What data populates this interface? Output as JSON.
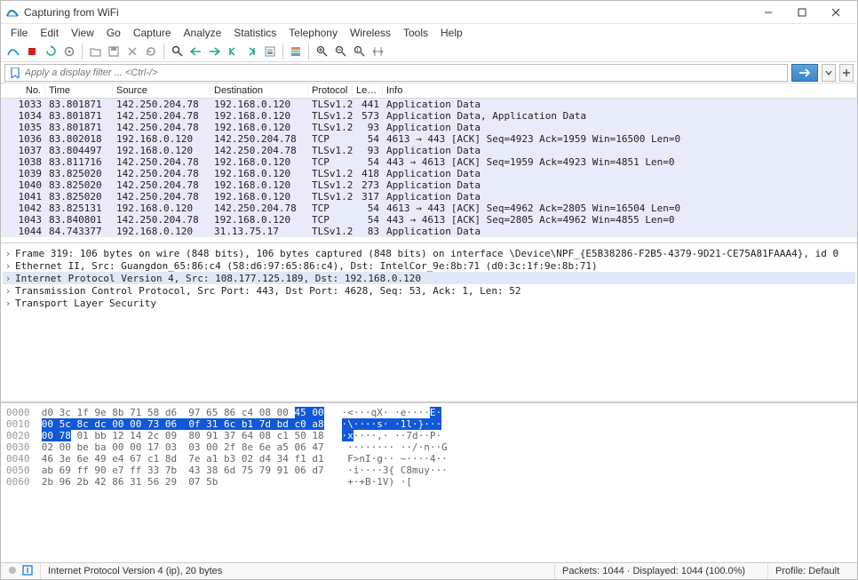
{
  "window": {
    "title": "Capturing from WiFi"
  },
  "menu": [
    "File",
    "Edit",
    "View",
    "Go",
    "Capture",
    "Analyze",
    "Statistics",
    "Telephony",
    "Wireless",
    "Tools",
    "Help"
  ],
  "filter": {
    "placeholder": "Apply a display filter ... <Ctrl-/>"
  },
  "list": {
    "headers": [
      "No.",
      "Time",
      "Source",
      "Destination",
      "Protocol",
      "Length",
      "Info"
    ],
    "rows": [
      {
        "no": "1033",
        "time": "83.801871",
        "src": "142.250.204.78",
        "dst": "192.168.0.120",
        "proto": "TLSv1.2",
        "len": "441",
        "info": "Application Data"
      },
      {
        "no": "1034",
        "time": "83.801871",
        "src": "142.250.204.78",
        "dst": "192.168.0.120",
        "proto": "TLSv1.2",
        "len": "573",
        "info": "Application Data, Application Data"
      },
      {
        "no": "1035",
        "time": "83.801871",
        "src": "142.250.204.78",
        "dst": "192.168.0.120",
        "proto": "TLSv1.2",
        "len": "93",
        "info": "Application Data"
      },
      {
        "no": "1036",
        "time": "83.802018",
        "src": "192.168.0.120",
        "dst": "142.250.204.78",
        "proto": "TCP",
        "len": "54",
        "info": "4613 → 443 [ACK] Seq=4923 Ack=1959 Win=16500 Len=0"
      },
      {
        "no": "1037",
        "time": "83.804497",
        "src": "192.168.0.120",
        "dst": "142.250.204.78",
        "proto": "TLSv1.2",
        "len": "93",
        "info": "Application Data"
      },
      {
        "no": "1038",
        "time": "83.811716",
        "src": "142.250.204.78",
        "dst": "192.168.0.120",
        "proto": "TCP",
        "len": "54",
        "info": "443 → 4613 [ACK] Seq=1959 Ack=4923 Win=4851 Len=0"
      },
      {
        "no": "1039",
        "time": "83.825020",
        "src": "142.250.204.78",
        "dst": "192.168.0.120",
        "proto": "TLSv1.2",
        "len": "418",
        "info": "Application Data"
      },
      {
        "no": "1040",
        "time": "83.825020",
        "src": "142.250.204.78",
        "dst": "192.168.0.120",
        "proto": "TLSv1.2",
        "len": "273",
        "info": "Application Data"
      },
      {
        "no": "1041",
        "time": "83.825020",
        "src": "142.250.204.78",
        "dst": "192.168.0.120",
        "proto": "TLSv1.2",
        "len": "317",
        "info": "Application Data"
      },
      {
        "no": "1042",
        "time": "83.825131",
        "src": "192.168.0.120",
        "dst": "142.250.204.78",
        "proto": "TCP",
        "len": "54",
        "info": "4613 → 443 [ACK] Seq=4962 Ack=2805 Win=16504 Len=0"
      },
      {
        "no": "1043",
        "time": "83.840801",
        "src": "142.250.204.78",
        "dst": "192.168.0.120",
        "proto": "TCP",
        "len": "54",
        "info": "443 → 4613 [ACK] Seq=2805 Ack=4962 Win=4855 Len=0"
      },
      {
        "no": "1044",
        "time": "84.743377",
        "src": "192.168.0.120",
        "dst": "31.13.75.17",
        "proto": "TLSv1.2",
        "len": "83",
        "info": "Application Data"
      }
    ]
  },
  "details": [
    {
      "text": "Frame 319: 106 bytes on wire (848 bits), 106 bytes captured (848 bits) on interface \\Device\\NPF_{E5B38286-F2B5-4379-9D21-CE75A81FAAA4}, id 0",
      "sel": false
    },
    {
      "text": "Ethernet II, Src: Guangdon_65:86:c4 (58:d6:97:65:86:c4), Dst: IntelCor_9e:8b:71 (d0:3c:1f:9e:8b:71)",
      "sel": false
    },
    {
      "text": "Internet Protocol Version 4, Src: 108.177.125.189, Dst: 192.168.0.120",
      "sel": true
    },
    {
      "text": "Transmission Control Protocol, Src Port: 443, Dst Port: 4628, Seq: 53, Ack: 1, Len: 52",
      "sel": false
    },
    {
      "text": "Transport Layer Security",
      "sel": false
    }
  ],
  "hex": [
    {
      "addr": "0000",
      "pre": "d0 3c 1f 9e 8b 71 58 d6  97 65 86 c4 08 00 ",
      "hl": "45 00",
      "post": "",
      "asc_pre": "·<···qX· ·e····",
      "asc_hl": "E·",
      "asc_post": ""
    },
    {
      "addr": "0010",
      "pre": "",
      "hl": "00 5c 8c dc 00 00 73 06  0f 31 6c b1 7d bd c0 a8",
      "post": "",
      "asc_pre": "",
      "asc_hl": "·\\····s· ·1l·}···",
      "asc_post": ""
    },
    {
      "addr": "0020",
      "pre": "",
      "hl": "00 78",
      "post": " 01 bb 12 14 2c 09  80 91 37 64 08 c1 50 18",
      "asc_pre": "",
      "asc_hl": "·x",
      "asc_post": "····,· ··7d··P·"
    },
    {
      "addr": "0030",
      "pre": "02 00 be ba 00 00 17 03  03 00 2f 8e 6e a5 06 47",
      "hl": "",
      "post": "",
      "asc_pre": "········ ··/·n··G",
      "asc_hl": "",
      "asc_post": ""
    },
    {
      "addr": "0040",
      "pre": "46 3e 6e 49 e4 67 c1 8d  7e a1 b3 02 d4 34 f1 d1",
      "hl": "",
      "post": "",
      "asc_pre": "F>nI·g·· ~····4··",
      "asc_hl": "",
      "asc_post": ""
    },
    {
      "addr": "0050",
      "pre": "ab 69 ff 90 e7 ff 33 7b  43 38 6d 75 79 91 06 d7",
      "hl": "",
      "post": "",
      "asc_pre": "·i····3{ C8muy···",
      "asc_hl": "",
      "asc_post": ""
    },
    {
      "addr": "0060",
      "pre": "2b 96 2b 42 86 31 56 29  07 5b",
      "hl": "",
      "post": "",
      "asc_pre": "+·+B·1V) ·[",
      "asc_hl": "",
      "asc_post": ""
    }
  ],
  "status": {
    "left": "Internet Protocol Version 4 (ip), 20 bytes",
    "packets": "Packets: 1044 · Displayed: 1044 (100.0%)",
    "profile": "Profile: Default"
  },
  "toolbar": {
    "icons": [
      "shark-fin-icon",
      "stop-icon",
      "restart-icon",
      "settings-icon",
      "open-icon",
      "save-icon",
      "close-file-icon",
      "reload-icon",
      "search-icon",
      "arrow-left-icon",
      "arrow-right-icon",
      "jump-first-icon",
      "jump-last-icon",
      "auto-scroll-icon",
      "colorize-icon",
      "zoom-in-icon",
      "zoom-out-icon",
      "zoom-reset-icon",
      "resize-columns-icon"
    ]
  }
}
